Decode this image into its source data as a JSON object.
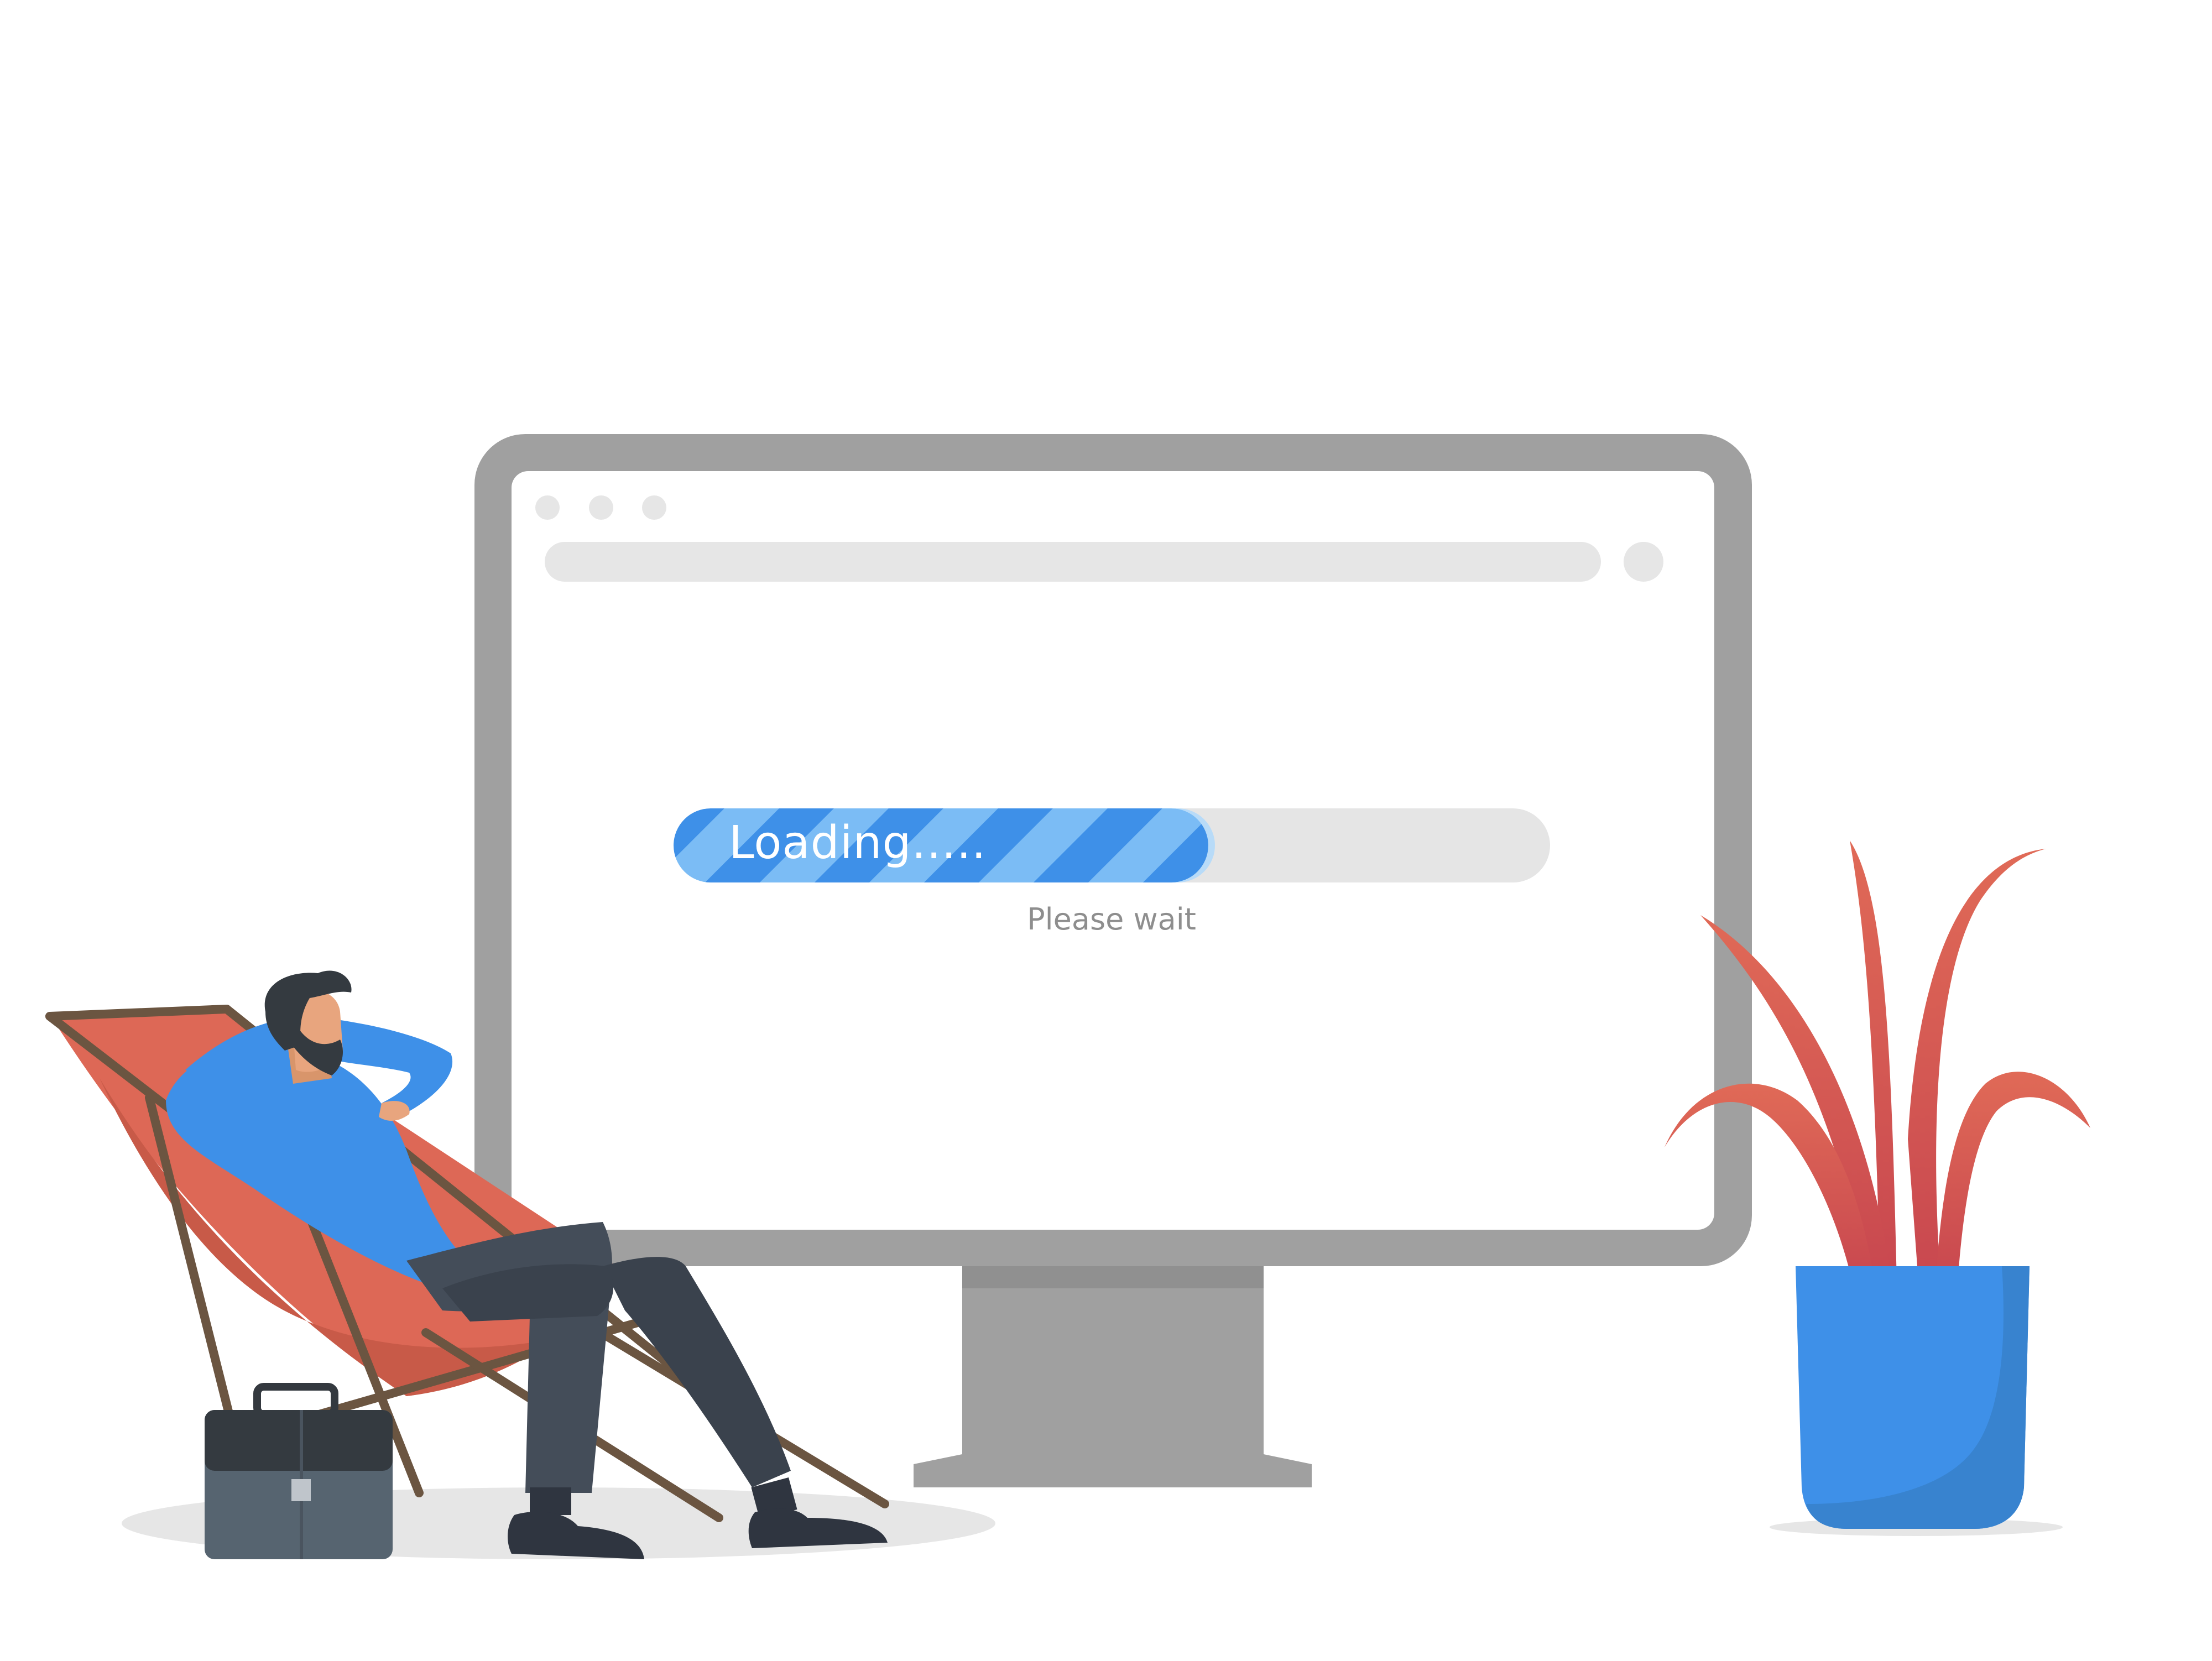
{
  "screen": {
    "loading_text": "Loading.....",
    "status_text": "Please wait",
    "progress_fraction": 0.61
  },
  "icons": {
    "window_dots": "window-control-dots",
    "address_bar": "address-bar",
    "address_button": "address-bar-button",
    "person": "relaxing-man",
    "chair": "deck-chair",
    "briefcase": "briefcase",
    "plant": "potted-plant"
  },
  "colors": {
    "monitor_frame": "#a0a0a0",
    "screen": "#ffffff",
    "bar_track": "#e5e5e5",
    "bar_fill": "#3e90e8",
    "bar_stripe": "#7bbcf5",
    "chair_fabric": "#dd6856",
    "shirt": "#3e90e8",
    "trousers": "#444d59",
    "pot": "#3e90e8",
    "leaves": "#dd6856",
    "briefcase": "#566470"
  }
}
